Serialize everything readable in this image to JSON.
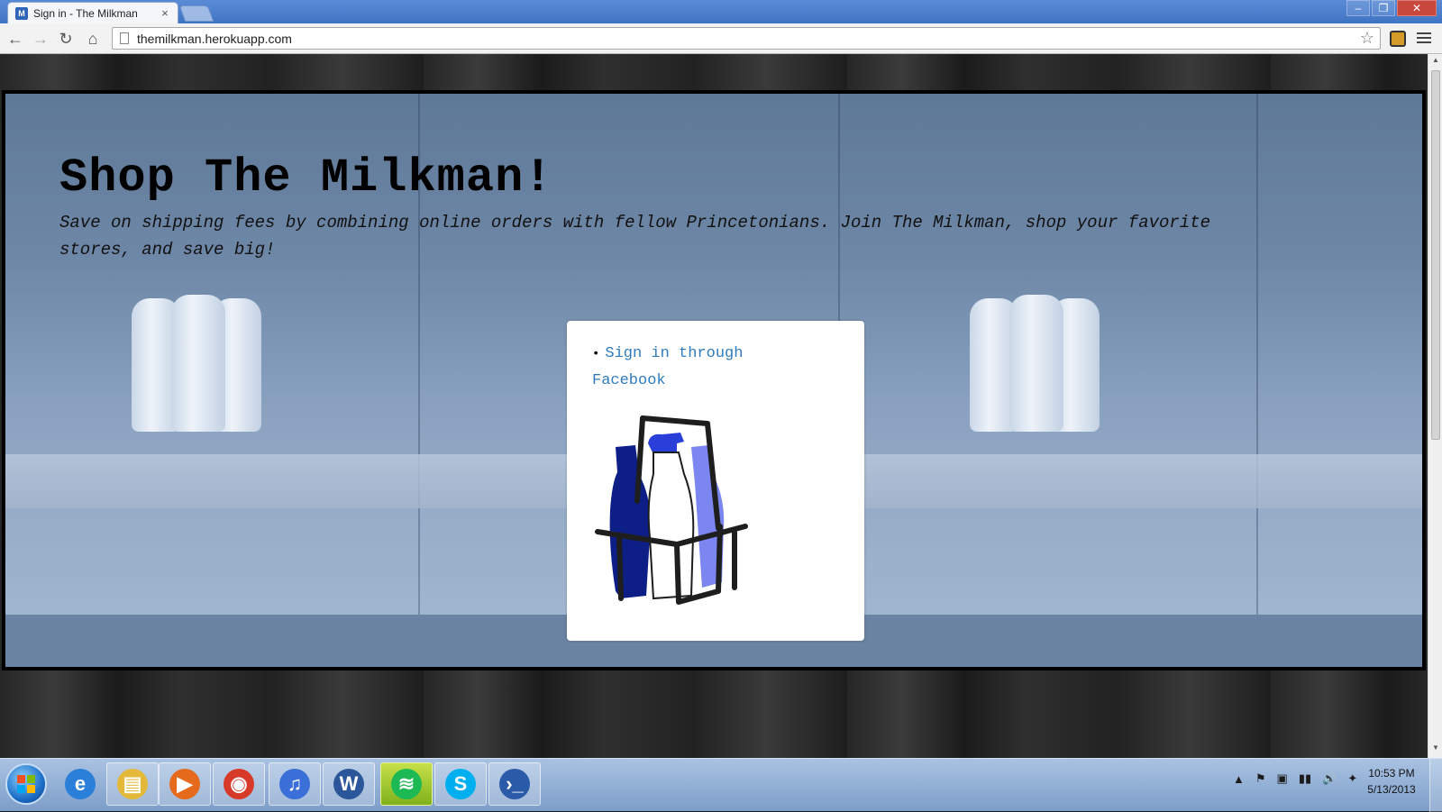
{
  "browser": {
    "tab_title": "Sign in - The Milkman",
    "tab_favicon": "M",
    "tab_close": "×",
    "url": "themilkman.herokuapp.com",
    "back_icon": "←",
    "forward_icon": "→",
    "reload_icon": "↻",
    "home_icon": "⌂",
    "star_icon": "☆",
    "minimize_icon": "–",
    "restore_icon": "❐",
    "close_icon": "✕"
  },
  "page": {
    "title": "Shop The Milkman!",
    "subtitle": "Save on shipping fees by combining online orders with fellow Princetonians. Join The Milkman, shop your favorite stores, and save big!",
    "signin_link": "Sign in through Facebook",
    "bullet": "•",
    "logo_colors": {
      "dark_bottle": "#0d1f86",
      "mid_bottle": "#2a3fd9",
      "light_bottle": "#7b86f0",
      "crate": "#1e1e1e"
    }
  },
  "taskbar": {
    "apps": [
      {
        "name": "Internet Explorer",
        "icon": "ie-icon",
        "glyph": "e"
      },
      {
        "name": "Windows Explorer",
        "icon": "folder-icon",
        "glyph": "▤"
      },
      {
        "name": "Media Player",
        "icon": "media-player-icon",
        "glyph": "▶"
      },
      {
        "name": "Google Chrome",
        "icon": "chrome-icon",
        "glyph": "◉"
      },
      {
        "name": "iTunes",
        "icon": "itunes-icon",
        "glyph": "♫"
      },
      {
        "name": "Microsoft Word",
        "icon": "word-icon",
        "glyph": "W"
      },
      {
        "name": "Spotify",
        "icon": "spotify-icon",
        "glyph": "≋"
      },
      {
        "name": "Skype",
        "icon": "skype-icon",
        "glyph": "S"
      },
      {
        "name": "PowerShell",
        "icon": "powershell-icon",
        "glyph": "›_"
      }
    ],
    "tray_icons": [
      "▲",
      "⚑",
      "▣",
      "▮▮",
      "🔊",
      "✦"
    ],
    "time": "10:53 PM",
    "date": "5/13/2013"
  }
}
